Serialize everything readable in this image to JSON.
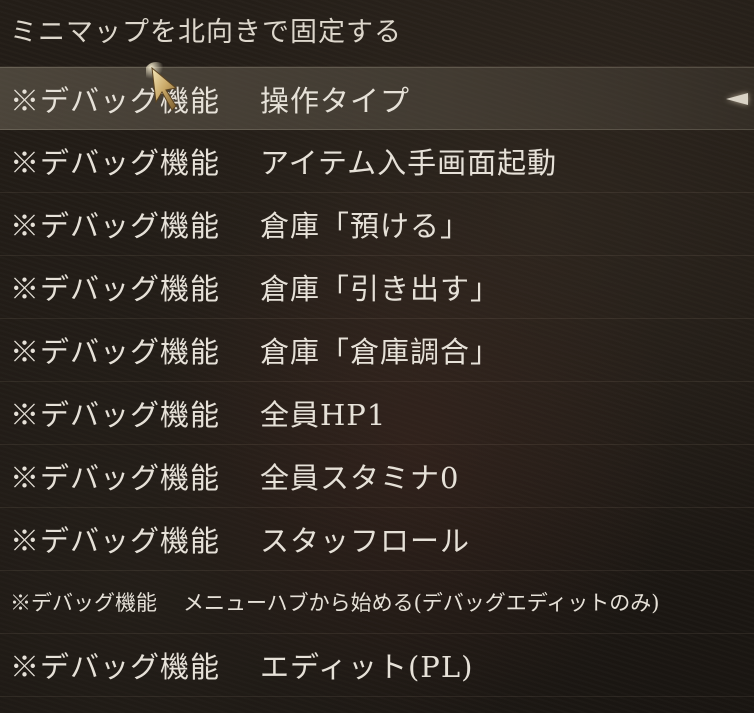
{
  "menu": {
    "header_item": "ミニマップを北向きで固定する",
    "items": [
      {
        "tag": "※デバッグ機能",
        "label": "操作タイプ",
        "selected": true
      },
      {
        "tag": "※デバッグ機能",
        "label": "アイテム入手画面起動"
      },
      {
        "tag": "※デバッグ機能",
        "label": "倉庫「預ける」"
      },
      {
        "tag": "※デバッグ機能",
        "label": "倉庫「引き出す」"
      },
      {
        "tag": "※デバッグ機能",
        "label": "倉庫「倉庫調合」"
      },
      {
        "tag": "※デバッグ機能",
        "label": "全員HP1"
      },
      {
        "tag": "※デバッグ機能",
        "label": "全員スタミナ0"
      },
      {
        "tag": "※デバッグ機能",
        "label": "スタッフロール"
      },
      {
        "tag": "※デバッグ機能",
        "label": "メニューハブから始める(デバッグエディットのみ)",
        "compact": true
      },
      {
        "tag": "※デバッグ機能",
        "label": "エディット(PL)"
      }
    ]
  },
  "icons": {
    "selection_indicator": "arrow-left-icon",
    "cursor": "quill-pointer-icon"
  },
  "colors": {
    "text": "#e6e1d8",
    "background": "#1e1914",
    "highlight": "#6e6658",
    "indicator": "#d9d3c6"
  }
}
